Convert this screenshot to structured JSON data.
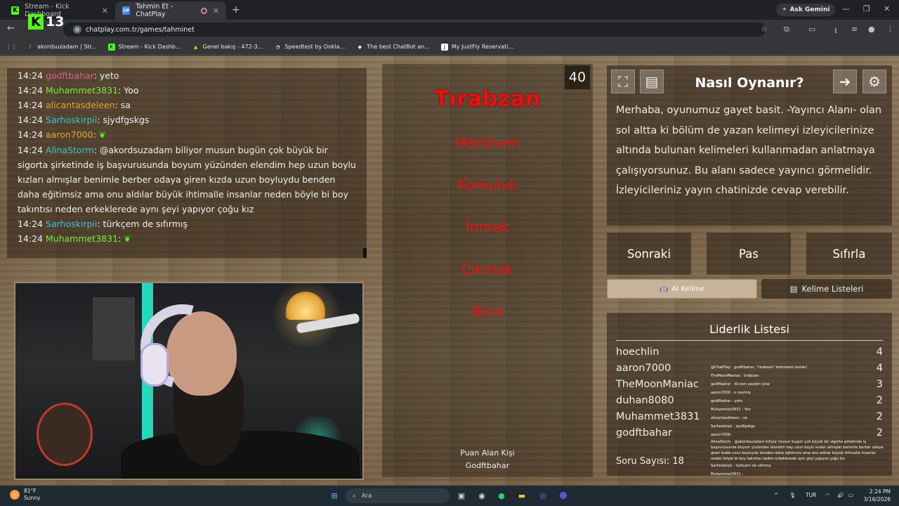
{
  "browser": {
    "tabs": [
      {
        "title": "Stream - Kick Dashboard",
        "favicon": "kick-icon"
      },
      {
        "title": "Tahmin Et - ChatPlay",
        "favicon": "chatplay-icon"
      }
    ],
    "ask_gemini": "Ask Gemini",
    "url": "chatplay.com.tr/games/tahminet",
    "kick_badge_number": "13",
    "bookmarks": [
      {
        "label": "akordsuzadam | Str...",
        "icon": "music-icon"
      },
      {
        "label": "Stream - Kick Dashb...",
        "icon": "kick-icon"
      },
      {
        "label": "Genel bakış - 472-3...",
        "icon": "drive-icon"
      },
      {
        "label": "Speedtest by Ookla...",
        "icon": "speedtest-icon"
      },
      {
        "label": "The best ChatBot an...",
        "icon": "chatbot-icon"
      },
      {
        "label": "My JustFly Reservati...",
        "icon": "justfly-icon"
      }
    ]
  },
  "chat": {
    "messages": [
      {
        "time": "14:24",
        "user": "godftbahar",
        "color": "#e0608a",
        "text": ": yeto"
      },
      {
        "time": "14:24",
        "user": "Muhammet3831",
        "color": "#7bea3a",
        "text": ": Yoo"
      },
      {
        "time": "14:24",
        "user": "alicantasdeleen",
        "color": "#f0a030",
        "text": ": sa"
      },
      {
        "time": "14:24",
        "user": "Sarhoskirpii",
        "color": "#3fc2cf",
        "text": ": sjydfgskgs"
      },
      {
        "time": "14:24",
        "user": "aaron7000",
        "color": "#f0a030",
        "text": ": "
      },
      {
        "time": "14:24",
        "user": "AlinaStorm",
        "color": "#3fc2cf",
        "text": ": @akordsuzadam biliyor musun bugün çok büyük bir sigorta şirketinde iş başvurusunda boyum yüzünden elendim hep uzun boylu kızları almışlar benimle berber odaya giren kızda uzun boyluydu benden daha eğitimsiz ama onu aldılar büyük ihtimalle insanlar neden böyle bi boy takıntısı neden erkeklerede aynı şeyi yapıyor çoğu kız"
      },
      {
        "time": "14:24",
        "user": "Sarhoskirpii",
        "color": "#3fc2cf",
        "text": ": türkçem de sıfırmış"
      },
      {
        "time": "14:24",
        "user": "Muhammet3831",
        "color": "#7bea3a",
        "text": ": "
      }
    ]
  },
  "game": {
    "timer": "40",
    "main_word": "Tırabzan",
    "forbidden_words": [
      "Merdiven",
      "Korkuluk",
      "İnmek",
      "Çıkmak",
      "Bina"
    ],
    "scorer_label": "Puan Alan Kişi",
    "scorer_name": "Godftbahar"
  },
  "howto": {
    "title": "Nasıl Oynanır?",
    "body": "Merhaba, oyunumuz gayet basit. -Yayıncı Alanı- olan sol altta ki bölüm de yazan kelimeyi izleyicilerinize altında bulunan kelimeleri kullanmadan anlatmaya çalışıyorsunuz. Bu alanı sadece yayıncı görmelidir. İzleyicileriniz yayın chatinizde cevap verebilir."
  },
  "controls": {
    "next": "Sonraki",
    "pass": "Pas",
    "reset": "Sıfırla",
    "ai_word": "AI Kelime",
    "word_lists": "Kelime Listeleri"
  },
  "leaderboard": {
    "title": "Liderlik Listesi",
    "rows": [
      {
        "name": "hoechlin",
        "score": "4"
      },
      {
        "name": "aaron7000",
        "score": "4"
      },
      {
        "name": "TheMoonManiac",
        "score": "3"
      },
      {
        "name": "duhan8080",
        "score": "2"
      },
      {
        "name": "Muhammet3831",
        "score": "2"
      },
      {
        "name": "godftbahar",
        "score": "2"
      }
    ],
    "question_count": "Soru Sayısı: 18"
  },
  "overlay_chat": [
    "@ChatPlay : godftbahar, \"tırabzan\" kelimesini buldu!",
    "TheMoonManiac : tırabzan",
    "godftbahar : ilk ben yazdım yine",
    "aaron7000 : o neymiş",
    "godftbahar : yeto",
    "Muhammet3831 : Yoo",
    "alicantasdeleen : sa",
    "Sarhoskirpii : sjydfgskgs",
    "aaron7000 :",
    "AlinaStorm : @akordsuzadam biliyor musun bugün çok büyük bir sigorta şirketinde iş başvurusunda boyum yüzünden elendim hep uzun boylu kızları almışlar benimle berber odaya giren kızda uzun boyluydu benden daha eğitimsiz ama onu aldılar büyük ihtimalle insanlar neden böyle bi boy takıntısı neden erkeklerede aynı şeyi yapıyor çoğu kız",
    "Sarhoskirpii : türkçem de sıfırmış",
    "Muhammet3831 :"
  ],
  "taskbar": {
    "weather_temp": "81°F",
    "weather_desc": "Sunny",
    "search_placeholder": "Ara",
    "lang": "TUR",
    "time": "2:24 PM",
    "date": "3/16/2026"
  },
  "colors": {
    "main_word": "#e81010",
    "kick_green": "#53fc18"
  }
}
